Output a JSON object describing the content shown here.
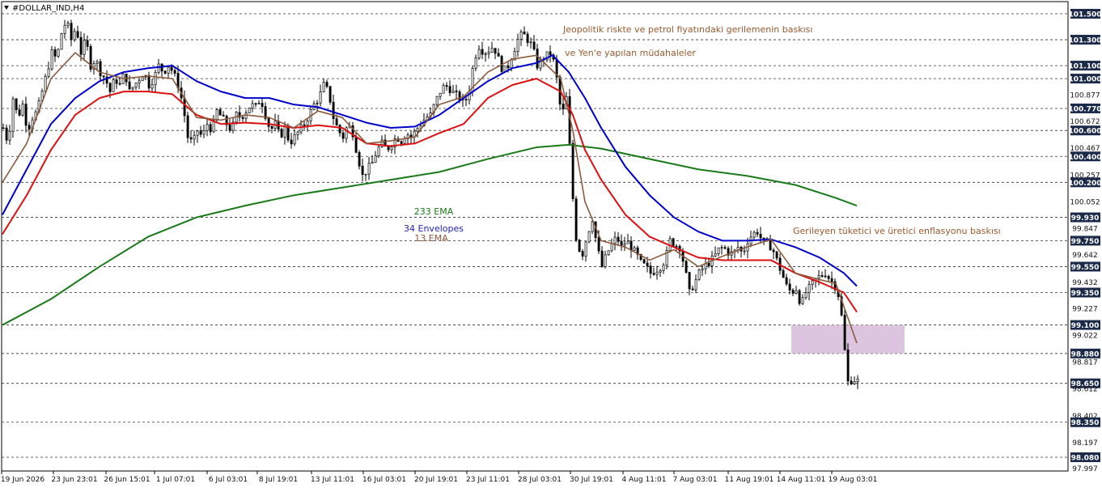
{
  "window": {
    "title": "#DOLLAR_IND,H4",
    "menu_icon": "triangle-down-icon"
  },
  "colors": {
    "ema233": "#1a7a1a",
    "envelope34": "#0000cc",
    "ema13": "#8b5a3c",
    "red_line": "#dd1111",
    "zone": "#d8bfdc",
    "annotation": "#9b5a2e",
    "candle": "#000000",
    "boxed_label_bg": "#1c2a4a"
  },
  "annotations": {
    "geo": "Jeopolitik riskte ve petrol fiyatındaki gerilemenin baskısı",
    "yen": "ve Yen'e yapılan müdahaleler",
    "inflation": "Gerileyen tüketici ve üretici enflasyonu baskısı",
    "ema233": "233 EMA",
    "env34": "34 Envelopes",
    "ema13": "13.EMA"
  },
  "chart_data": {
    "type": "candlestick",
    "symbol": "#DOLLAR_IND",
    "timeframe": "H4",
    "ylim": [
      97.997,
      101.57
    ],
    "y_ticks": [
      101.5,
      101.3,
      101.1,
      101.0,
      100.877,
      100.77,
      100.672,
      100.6,
      100.467,
      100.4,
      100.257,
      100.2,
      100.052,
      99.93,
      99.847,
      99.75,
      99.642,
      99.55,
      99.432,
      99.35,
      99.227,
      99.1,
      99.022,
      98.88,
      98.817,
      98.667,
      98.65,
      98.612,
      98.402,
      98.35,
      98.197,
      98.08,
      97.997
    ],
    "y_tick_labels": [
      "101.500",
      "101.300",
      "101.100",
      "101.000",
      "100.877",
      "100.770",
      "100.672",
      "100.600",
      "100.467",
      "100.400",
      "100.257",
      "100.200",
      "100.052",
      "99.930",
      "99.847",
      "99.750",
      "99.642",
      "99.550",
      "99.432",
      "99.350",
      "99.227",
      "99.100",
      "99.022",
      "98.880",
      "98.817",
      "98.667",
      "98.650",
      "98.612",
      "98.402",
      "98.350",
      "98.197",
      "98.080",
      "97.997"
    ],
    "horizontal_levels": [
      101.5,
      101.3,
      101.1,
      101.0,
      100.77,
      100.6,
      100.4,
      100.2,
      99.93,
      99.75,
      99.55,
      99.35,
      99.1,
      98.88,
      98.65,
      98.35,
      98.08
    ],
    "boxed_levels": [
      "101.500",
      "101.300",
      "101.100",
      "101.000",
      "100.770",
      "100.600",
      "100.400",
      "100.200",
      "99.930",
      "99.750",
      "99.550",
      "99.350",
      "99.100",
      "98.880",
      "98.650",
      "98.350",
      "98.080"
    ],
    "x_labels": [
      "19 Jun 2026",
      "23 Jun 23:01",
      "26 Jun 15:01",
      "1 Jul 07:01",
      "6 Jul 03:01",
      "8 Jul 19:01",
      "13 Jul 11:01",
      "16 Jul 03:01",
      "20 Jul 19:01",
      "23 Jul 11:01",
      "28 Jul 03:01",
      "30 Jul 19:01",
      "4 Aug 11:01",
      "7 Aug 03:01",
      "11 Aug 19:01",
      "14 Aug 11:01",
      "19 Aug 03:01"
    ],
    "close_path": [
      [
        0,
        100.62
      ],
      [
        6,
        100.5
      ],
      [
        12,
        100.85
      ],
      [
        18,
        100.7
      ],
      [
        24,
        100.8
      ],
      [
        30,
        100.6
      ],
      [
        36,
        100.7
      ],
      [
        42,
        100.75
      ],
      [
        48,
        100.9
      ],
      [
        54,
        101.05
      ],
      [
        60,
        101.2
      ],
      [
        66,
        101.15
      ],
      [
        72,
        101.35
      ],
      [
        78,
        101.45
      ],
      [
        84,
        101.3
      ],
      [
        90,
        101.4
      ],
      [
        96,
        101.2
      ],
      [
        102,
        101.3
      ],
      [
        108,
        101.1
      ],
      [
        114,
        101.15
      ],
      [
        120,
        101.05
      ],
      [
        126,
        101.0
      ],
      [
        132,
        100.9
      ],
      [
        138,
        101.0
      ],
      [
        144,
        100.95
      ],
      [
        150,
        101.05
      ],
      [
        156,
        100.9
      ],
      [
        162,
        100.95
      ],
      [
        168,
        101.0
      ],
      [
        174,
        101.05
      ],
      [
        180,
        100.95
      ],
      [
        186,
        101.0
      ],
      [
        192,
        101.1
      ],
      [
        198,
        101.05
      ],
      [
        204,
        101.1
      ],
      [
        210,
        101.05
      ],
      [
        216,
        100.95
      ],
      [
        222,
        100.8
      ],
      [
        228,
        100.55
      ],
      [
        234,
        100.5
      ],
      [
        240,
        100.6
      ],
      [
        246,
        100.55
      ],
      [
        252,
        100.65
      ],
      [
        258,
        100.6
      ],
      [
        264,
        100.75
      ],
      [
        270,
        100.7
      ],
      [
        276,
        100.65
      ],
      [
        282,
        100.6
      ],
      [
        288,
        100.72
      ],
      [
        294,
        100.7
      ],
      [
        300,
        100.75
      ],
      [
        306,
        100.8
      ],
      [
        312,
        100.78
      ],
      [
        318,
        100.85
      ],
      [
        324,
        100.72
      ],
      [
        330,
        100.6
      ],
      [
        336,
        100.65
      ],
      [
        342,
        100.55
      ],
      [
        348,
        100.62
      ],
      [
        354,
        100.5
      ],
      [
        360,
        100.55
      ],
      [
        366,
        100.6
      ],
      [
        372,
        100.65
      ],
      [
        378,
        100.72
      ],
      [
        384,
        100.8
      ],
      [
        390,
        100.85
      ],
      [
        396,
        100.95
      ],
      [
        402,
        100.9
      ],
      [
        408,
        100.7
      ],
      [
        414,
        100.6
      ],
      [
        420,
        100.55
      ],
      [
        426,
        100.65
      ],
      [
        432,
        100.58
      ],
      [
        438,
        100.4
      ],
      [
        444,
        100.25
      ],
      [
        450,
        100.3
      ],
      [
        456,
        100.35
      ],
      [
        462,
        100.45
      ],
      [
        468,
        100.5
      ],
      [
        474,
        100.45
      ],
      [
        480,
        100.5
      ],
      [
        486,
        100.55
      ],
      [
        492,
        100.52
      ],
      [
        498,
        100.58
      ],
      [
        504,
        100.55
      ],
      [
        510,
        100.6
      ],
      [
        516,
        100.65
      ],
      [
        522,
        100.7
      ],
      [
        528,
        100.72
      ],
      [
        534,
        100.82
      ],
      [
        540,
        100.9
      ],
      [
        546,
        100.95
      ],
      [
        552,
        100.92
      ],
      [
        558,
        100.88
      ],
      [
        564,
        100.85
      ],
      [
        570,
        100.8
      ],
      [
        576,
        100.92
      ],
      [
        582,
        101.15
      ],
      [
        588,
        101.25
      ],
      [
        594,
        101.2
      ],
      [
        600,
        101.22
      ],
      [
        606,
        101.25
      ],
      [
        612,
        101.15
      ],
      [
        618,
        101.05
      ],
      [
        624,
        101.1
      ],
      [
        630,
        101.2
      ],
      [
        636,
        101.3
      ],
      [
        642,
        101.35
      ],
      [
        648,
        101.3
      ],
      [
        654,
        101.25
      ],
      [
        660,
        101.1
      ],
      [
        666,
        101.15
      ],
      [
        672,
        101.18
      ],
      [
        678,
        101.2
      ],
      [
        684,
        101.0
      ],
      [
        690,
        100.7
      ],
      [
        696,
        100.85
      ],
      [
        702,
        100.3
      ],
      [
        706,
        99.85
      ],
      [
        710,
        99.7
      ],
      [
        716,
        99.65
      ],
      [
        722,
        99.8
      ],
      [
        728,
        99.92
      ],
      [
        734,
        99.7
      ],
      [
        740,
        99.55
      ],
      [
        746,
        99.65
      ],
      [
        752,
        99.72
      ],
      [
        758,
        99.78
      ],
      [
        764,
        99.7
      ],
      [
        770,
        99.75
      ],
      [
        776,
        99.7
      ],
      [
        782,
        99.65
      ],
      [
        788,
        99.58
      ],
      [
        794,
        99.55
      ],
      [
        800,
        99.5
      ],
      [
        806,
        99.52
      ],
      [
        812,
        99.55
      ],
      [
        818,
        99.6
      ],
      [
        824,
        99.75
      ],
      [
        830,
        99.72
      ],
      [
        836,
        99.7
      ],
      [
        842,
        99.55
      ],
      [
        848,
        99.35
      ],
      [
        854,
        99.42
      ],
      [
        860,
        99.5
      ],
      [
        866,
        99.55
      ],
      [
        872,
        99.58
      ],
      [
        878,
        99.62
      ],
      [
        884,
        99.68
      ],
      [
        890,
        99.7
      ],
      [
        896,
        99.66
      ],
      [
        902,
        99.65
      ],
      [
        908,
        99.7
      ],
      [
        914,
        99.65
      ],
      [
        920,
        99.75
      ],
      [
        926,
        99.8
      ],
      [
        932,
        99.82
      ],
      [
        938,
        99.75
      ],
      [
        944,
        99.72
      ],
      [
        950,
        99.7
      ],
      [
        956,
        99.6
      ],
      [
        962,
        99.5
      ],
      [
        968,
        99.4
      ],
      [
        974,
        99.35
      ],
      [
        980,
        99.38
      ],
      [
        986,
        99.25
      ],
      [
        992,
        99.35
      ],
      [
        998,
        99.4
      ],
      [
        1004,
        99.45
      ],
      [
        1010,
        99.48
      ],
      [
        1016,
        99.5
      ],
      [
        1022,
        99.45
      ],
      [
        1028,
        99.4
      ],
      [
        1034,
        99.3
      ],
      [
        1040,
        98.9
      ],
      [
        1044,
        98.66
      ],
      [
        1050,
        98.68
      ],
      [
        1056,
        98.67
      ]
    ],
    "ema233": [
      [
        0,
        99.1
      ],
      [
        60,
        99.3
      ],
      [
        120,
        99.55
      ],
      [
        180,
        99.78
      ],
      [
        240,
        99.93
      ],
      [
        300,
        100.02
      ],
      [
        360,
        100.1
      ],
      [
        420,
        100.16
      ],
      [
        480,
        100.22
      ],
      [
        540,
        100.28
      ],
      [
        600,
        100.38
      ],
      [
        660,
        100.47
      ],
      [
        700,
        100.49
      ],
      [
        740,
        100.46
      ],
      [
        800,
        100.38
      ],
      [
        860,
        100.3
      ],
      [
        920,
        100.25
      ],
      [
        980,
        100.18
      ],
      [
        1030,
        100.08
      ],
      [
        1056,
        100.02
      ]
    ],
    "envelope34": [
      [
        0,
        99.95
      ],
      [
        30,
        100.3
      ],
      [
        60,
        100.65
      ],
      [
        90,
        100.85
      ],
      [
        120,
        100.98
      ],
      [
        150,
        101.05
      ],
      [
        180,
        101.08
      ],
      [
        210,
        101.1
      ],
      [
        240,
        100.98
      ],
      [
        270,
        100.9
      ],
      [
        300,
        100.85
      ],
      [
        330,
        100.85
      ],
      [
        360,
        100.8
      ],
      [
        390,
        100.78
      ],
      [
        420,
        100.72
      ],
      [
        450,
        100.66
      ],
      [
        480,
        100.62
      ],
      [
        510,
        100.63
      ],
      [
        540,
        100.72
      ],
      [
        570,
        100.85
      ],
      [
        600,
        100.98
      ],
      [
        630,
        101.08
      ],
      [
        660,
        101.12
      ],
      [
        680,
        101.18
      ],
      [
        700,
        101.05
      ],
      [
        720,
        100.85
      ],
      [
        740,
        100.62
      ],
      [
        770,
        100.32
      ],
      [
        800,
        100.1
      ],
      [
        830,
        99.93
      ],
      [
        860,
        99.82
      ],
      [
        890,
        99.75
      ],
      [
        920,
        99.75
      ],
      [
        950,
        99.76
      ],
      [
        980,
        99.7
      ],
      [
        1010,
        99.62
      ],
      [
        1040,
        99.5
      ],
      [
        1056,
        99.4
      ]
    ],
    "ema13": [
      [
        0,
        100.2
      ],
      [
        30,
        100.5
      ],
      [
        60,
        101.0
      ],
      [
        90,
        101.2
      ],
      [
        120,
        101.05
      ],
      [
        150,
        101.0
      ],
      [
        180,
        101.02
      ],
      [
        210,
        101.0
      ],
      [
        240,
        100.7
      ],
      [
        270,
        100.68
      ],
      [
        300,
        100.72
      ],
      [
        330,
        100.7
      ],
      [
        360,
        100.62
      ],
      [
        390,
        100.75
      ],
      [
        420,
        100.7
      ],
      [
        450,
        100.5
      ],
      [
        480,
        100.52
      ],
      [
        510,
        100.55
      ],
      [
        540,
        100.8
      ],
      [
        570,
        100.86
      ],
      [
        600,
        101.05
      ],
      [
        630,
        101.15
      ],
      [
        660,
        101.18
      ],
      [
        690,
        101.0
      ],
      [
        705,
        100.6
      ],
      [
        720,
        100.05
      ],
      [
        740,
        99.75
      ],
      [
        770,
        99.7
      ],
      [
        800,
        99.6
      ],
      [
        830,
        99.68
      ],
      [
        860,
        99.55
      ],
      [
        890,
        99.63
      ],
      [
        920,
        99.7
      ],
      [
        950,
        99.76
      ],
      [
        980,
        99.5
      ],
      [
        1010,
        99.45
      ],
      [
        1030,
        99.42
      ],
      [
        1056,
        98.96
      ]
    ],
    "red_line": [
      [
        0,
        99.8
      ],
      [
        30,
        100.1
      ],
      [
        60,
        100.45
      ],
      [
        90,
        100.72
      ],
      [
        120,
        100.85
      ],
      [
        150,
        100.9
      ],
      [
        180,
        100.9
      ],
      [
        210,
        100.88
      ],
      [
        240,
        100.72
      ],
      [
        270,
        100.65
      ],
      [
        300,
        100.66
      ],
      [
        330,
        100.65
      ],
      [
        360,
        100.62
      ],
      [
        390,
        100.64
      ],
      [
        420,
        100.62
      ],
      [
        450,
        100.5
      ],
      [
        480,
        100.48
      ],
      [
        510,
        100.5
      ],
      [
        540,
        100.58
      ],
      [
        570,
        100.65
      ],
      [
        600,
        100.85
      ],
      [
        630,
        100.95
      ],
      [
        660,
        101.0
      ],
      [
        690,
        100.9
      ],
      [
        705,
        100.72
      ],
      [
        720,
        100.45
      ],
      [
        740,
        100.22
      ],
      [
        770,
        99.95
      ],
      [
        800,
        99.78
      ],
      [
        830,
        99.7
      ],
      [
        860,
        99.62
      ],
      [
        890,
        99.6
      ],
      [
        920,
        99.6
      ],
      [
        950,
        99.6
      ],
      [
        980,
        99.5
      ],
      [
        1010,
        99.43
      ],
      [
        1040,
        99.35
      ],
      [
        1056,
        99.2
      ]
    ],
    "zone": {
      "x0": 975,
      "x1": 1115,
      "y_top": 99.1,
      "y_bottom": 98.88
    }
  }
}
